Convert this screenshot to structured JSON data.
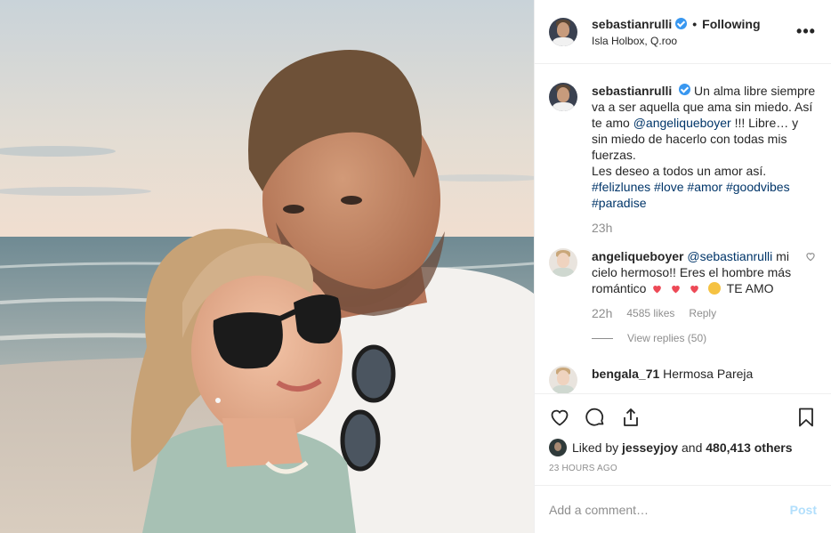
{
  "header": {
    "username": "sebastianrulli",
    "separator": "•",
    "follow_state": "Following",
    "location": "Isla Holbox, Q.roo",
    "more_label": "•••"
  },
  "caption": {
    "username": "sebastianrulli",
    "text_1": "Un alma libre siempre va a ser aquella que ama sin miedo.",
    "text_2a": "Así te amo",
    "mention": "@angeliqueboyer",
    "text_2b": "!!! Libre… y sin miedo de hacerlo con todas mis fuerzas.",
    "text_3": "Les deseo a todos un amor así.",
    "hashtags": [
      "#felizlunes",
      "#love",
      "#amor",
      "#goodvibes",
      "#paradise"
    ],
    "time": "23h"
  },
  "comments": [
    {
      "username": "angeliqueboyer",
      "mention": "@sebastianrulli",
      "text": "mi cielo hermoso!! Eres el hombre más romántico",
      "text_end": "TE AMO",
      "time": "22h",
      "likes": "4585 likes",
      "reply": "Reply",
      "view_replies": "View replies (50)"
    },
    {
      "username": "bengala_71",
      "text": "Hermosa Pareja"
    }
  ],
  "actions": {
    "liked_by_prefix": "Liked by",
    "liked_by_user": "jesseyjoy",
    "liked_by_and": "and",
    "liked_by_count": "480,413 others",
    "timestamp": "23 HOURS AGO"
  },
  "add_comment": {
    "placeholder": "Add a comment…",
    "post_label": "Post"
  },
  "colors": {
    "verified": "#3897f0",
    "link": "#003569",
    "muted": "#8e8e8e",
    "post_disabled": "#b2dffc",
    "heart": "#ed4956"
  }
}
